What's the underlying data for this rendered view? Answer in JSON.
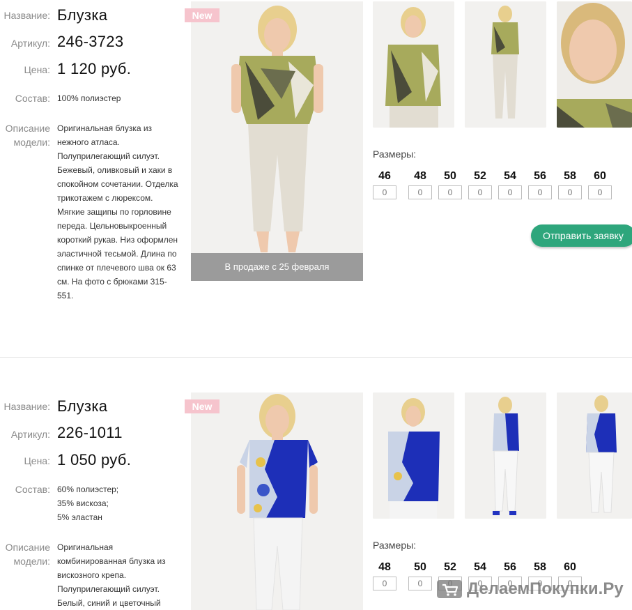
{
  "labels": {
    "name": "Название:",
    "article": "Артикул:",
    "price": "Цена:",
    "composition": "Состав:",
    "description": "Описание модели:",
    "sizes": "Размеры:",
    "new": "New",
    "order": "Отправить заявку"
  },
  "products": [
    {
      "name": "Блузка",
      "article": "246-3723",
      "price": "1 120 руб.",
      "composition": "100% полиэстер",
      "description": "Оригинальная блузка из нежного атласа. Полуприлегающий силуэт. Бежевый, оливковый и хаки в спокойном сочетании. Отделка трикотажем с люрексом. Мягкие защипы по горловине переда. Цельновыкроенный короткий рукав. Низ оформлен эластичной тесьмой. Длина по спинке от плечевого шва ок 63 см. На фото с брюками 315-551.",
      "sale_notice": "В продаже с 25 февраля",
      "sizes": [
        "46",
        "48",
        "50",
        "52",
        "54",
        "56",
        "58",
        "60"
      ],
      "quantities": [
        "0",
        "0",
        "0",
        "0",
        "0",
        "0",
        "0",
        "0"
      ],
      "colors": {
        "top": "#a7aa5c",
        "top_dark": "#4b4c3a",
        "pants": "#e2ddd2",
        "accent": "#2ea67c"
      }
    },
    {
      "name": "Блузка",
      "article": "226-1011",
      "price": "1 050 руб.",
      "composition_lines": [
        "60% полиэстер;",
        "35% вискоза;",
        "5% эластан"
      ],
      "description": "Оригинальная комбинированная блузка из вискозного крепа. Полуприлегающий силуэт. Белый, синий и цветочный",
      "sizes": [
        "48",
        "50",
        "52",
        "54",
        "56",
        "58",
        "60"
      ],
      "quantities": [
        "0",
        "0",
        "0",
        "0",
        "0",
        "0",
        "0"
      ],
      "colors": {
        "top": "#1d2fb8",
        "print": "#c9d3e6",
        "pants": "#f4f4f4"
      }
    }
  ],
  "watermark": {
    "text": "ДелаемПокупки.Ру",
    "icon": "cart-icon"
  }
}
